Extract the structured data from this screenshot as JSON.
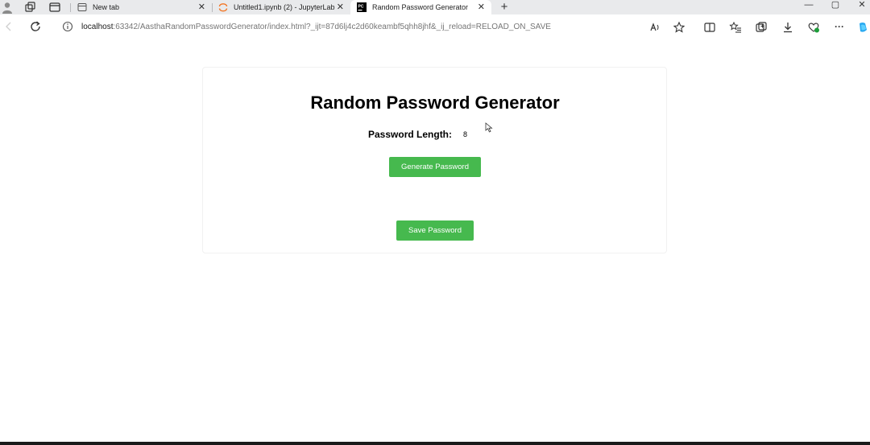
{
  "browser": {
    "tabs": [
      {
        "title": "New tab"
      },
      {
        "title": "Untitled1.ipynb (2) - JupyterLab"
      },
      {
        "title": "Random Password Generator",
        "favicon_text": "PC"
      }
    ],
    "new_tab_symbol": "+",
    "close_symbol": "✕",
    "window_controls": {
      "minimize": "—",
      "maximize": "▢",
      "close": "✕"
    },
    "address": {
      "host": "localhost",
      "rest": ":63342/AasthaRandomPasswordGenerator/index.html?_ijt=87d6lj4c2d60keambf5qhh8jhf&_ij_reload=RELOAD_ON_SAVE"
    },
    "more_symbol": "···",
    "icons": [
      "profile-icon",
      "workspaces-icon",
      "vertical-tabs-icon",
      "refresh-icon",
      "info-icon",
      "read-aloud-icon",
      "favorite-star-icon",
      "split-screen-icon",
      "favorites-icon",
      "collections-icon",
      "downloads-icon",
      "browser-essentials-icon",
      "more-icon",
      "copilot-icon"
    ]
  },
  "page": {
    "heading": "Random Password Generator",
    "length_label": "Password Length:",
    "length_value": "8",
    "generate_button": "Generate Password",
    "save_button": "Save Password"
  },
  "colors": {
    "button_green": "#46b94e",
    "tabstrip_bg": "#e9eaec"
  }
}
